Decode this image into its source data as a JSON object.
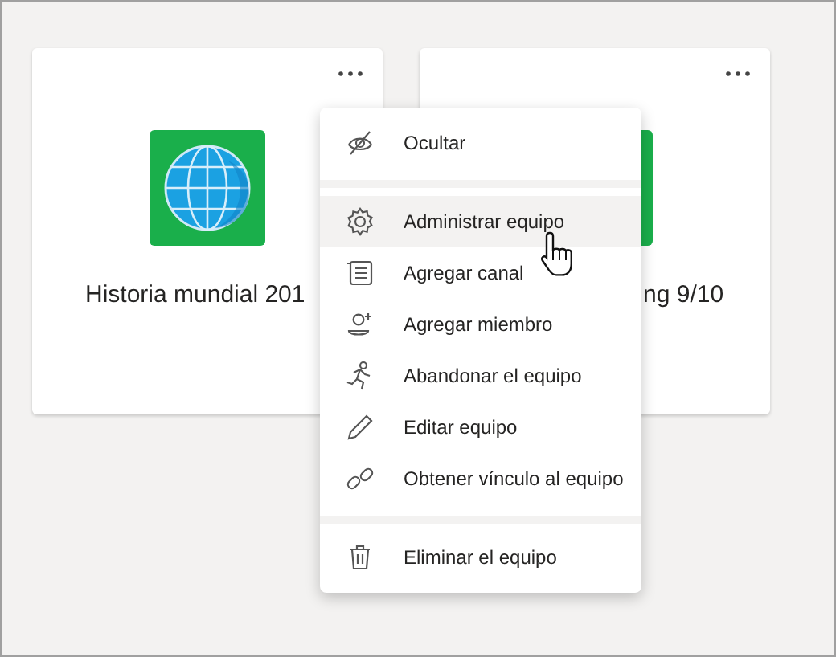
{
  "teams": [
    {
      "kind": "globe",
      "name": "Historia mundial 201"
    },
    {
      "kind": "plain",
      "name": "ng 9/10"
    }
  ],
  "menu": {
    "items": [
      {
        "kind": "item",
        "label": "Ocultar",
        "selected": false
      },
      {
        "kind": "divider"
      },
      {
        "kind": "item",
        "label": "Administrar equipo",
        "selected": true
      },
      {
        "kind": "item",
        "label": "Agregar canal",
        "selected": false
      },
      {
        "kind": "item",
        "label": "Agregar miembro",
        "selected": false
      },
      {
        "kind": "item",
        "label": "Abandonar el equipo",
        "selected": false
      },
      {
        "kind": "item",
        "label": "Editar equipo",
        "selected": false
      },
      {
        "kind": "item",
        "label": "Obtener vínculo al equipo",
        "selected": false
      },
      {
        "kind": "divider"
      },
      {
        "kind": "item",
        "label": "Eliminar el equipo",
        "selected": false
      }
    ]
  }
}
